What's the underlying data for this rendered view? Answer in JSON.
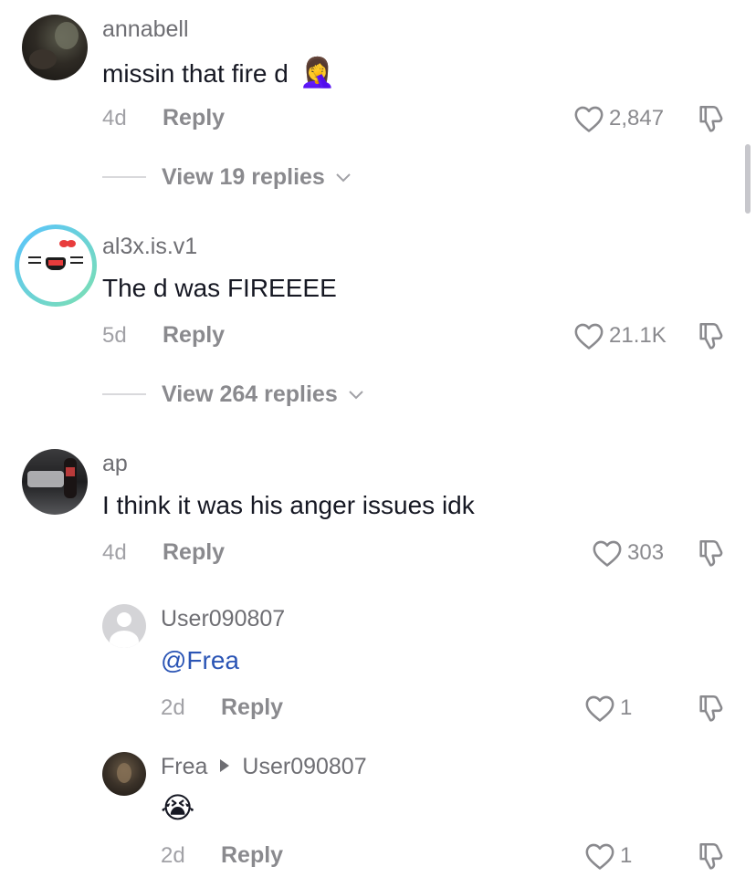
{
  "comments": [
    {
      "username": "annabell",
      "text": "missin that fire d",
      "emoji": "🤦‍♀️",
      "age": "4d",
      "reply_label": "Reply",
      "likes": "2,847",
      "view_replies": "View 19 replies"
    },
    {
      "username": "al3x.is.v1",
      "text": "The d was FIREEEE",
      "age": "5d",
      "reply_label": "Reply",
      "likes": "21.1K",
      "view_replies": "View 264 replies"
    },
    {
      "username": "ap",
      "text": "I think it was his anger issues idk",
      "age": "4d",
      "reply_label": "Reply",
      "likes": "303"
    }
  ],
  "replies": [
    {
      "username": "User090807",
      "text": "@Frea",
      "age": "2d",
      "reply_label": "Reply",
      "likes": "1"
    },
    {
      "username": "Frea",
      "reply_to": "User090807",
      "emoji": "😭",
      "age": "2d",
      "reply_label": "Reply",
      "likes": "1"
    }
  ],
  "colors": {
    "username": "#6e6e73",
    "meta": "#a1a1a6",
    "mention": "#2b55b5",
    "avatar_ring": [
      "#58c3ff",
      "#7de0b0"
    ]
  },
  "icons": [
    "heart-icon",
    "dislike-icon",
    "chevron-down-icon",
    "caret-right-icon"
  ]
}
